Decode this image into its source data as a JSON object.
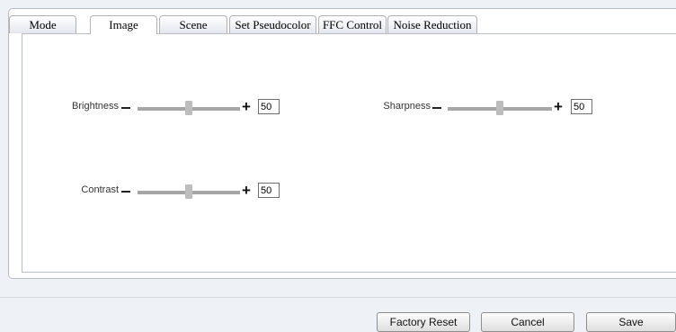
{
  "tabs": [
    {
      "label": "Mode",
      "active": false
    },
    {
      "label": "Image",
      "active": true
    },
    {
      "label": "Scene",
      "active": false
    },
    {
      "label": "Set Pseudocolor",
      "active": false
    },
    {
      "label": "FFC Control",
      "active": false
    },
    {
      "label": "Noise Reduction",
      "active": false
    }
  ],
  "sliders": {
    "brightness": {
      "label": "Brightness",
      "value": "50",
      "level": 0.5
    },
    "sharpness": {
      "label": "Sharpness",
      "value": "50",
      "level": 0.5
    },
    "contrast": {
      "label": "Contrast",
      "value": "50",
      "level": 0.5
    }
  },
  "buttons": {
    "factory_reset": "Factory Reset",
    "cancel": "Cancel",
    "save": "Save"
  },
  "icons": {
    "decrease": "minus-icon",
    "increase": "plus-icon"
  }
}
